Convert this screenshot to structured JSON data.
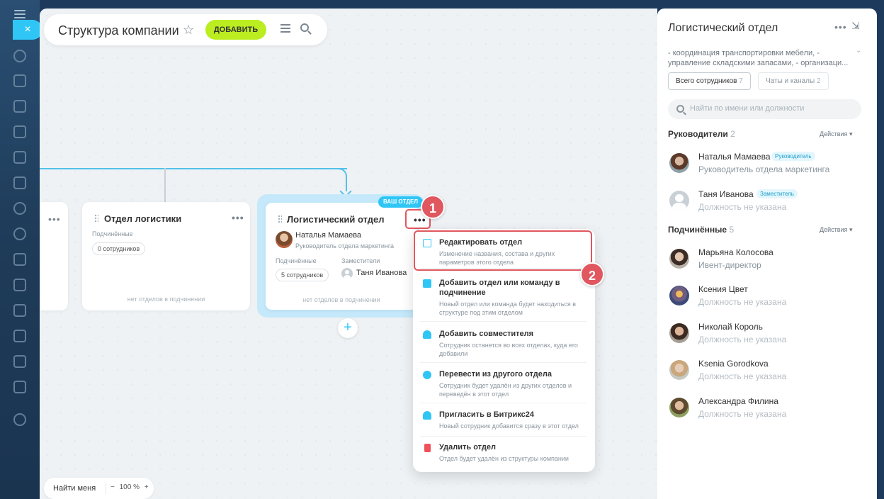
{
  "app": {
    "title": "Структура компании",
    "add_label": "ДОБАВИТЬ",
    "close_symbol": "×"
  },
  "canvas": {
    "find_me_label": "Найти меня",
    "zoom_minus": "−",
    "zoom_value": "100 %",
    "zoom_plus": "+",
    "add_child_symbol": "+"
  },
  "cards": {
    "logistics": {
      "name": "Отдел логистики",
      "subordinates_label": "Подчинённые",
      "subordinates_count": "0 сотрудников",
      "footer": "нет отделов в подчинении"
    },
    "logistic_dept": {
      "badge": "ВАШ ОТДЕЛ",
      "name": "Логистический отдел",
      "head_name": "Наталья Мамаева",
      "head_role": "Руководитель отдела маркетинга",
      "subordinates_label": "Подчинённые",
      "subordinates_count": "5 сотрудников",
      "deputies_label": "Заместители",
      "deputy_name": "Таня Иванова",
      "footer": "нет отделов в подчинении"
    }
  },
  "steps": [
    "1",
    "2"
  ],
  "menu": {
    "items": [
      {
        "title": "Редактировать отдел",
        "desc": "Изменение названия, состава и других параметров этого отдела",
        "icon": "edit-icon",
        "color": "#2fc6f6"
      },
      {
        "title": "Добавить отдел или команду в подчинение",
        "desc": "Новый отдел или команда будет находиться в структуре под этим отделом",
        "icon": "cube-add-icon",
        "color": "#2fc6f6"
      },
      {
        "title": "Добавить совместителя",
        "desc": "Сотрудник останется во всех отделах, куда его добавили",
        "icon": "user-add-icon",
        "color": "#2fc6f6"
      },
      {
        "title": "Перевести из другого отдела",
        "desc": "Сотрудник будет удалён из других отделов и переведён в этот отдел",
        "icon": "user-transfer-icon",
        "color": "#2fc6f6"
      },
      {
        "title": "Пригласить в Битрикс24",
        "desc": "Новый сотрудник добавится сразу в этот отдел",
        "icon": "invite-icon",
        "color": "#2fc6f6"
      },
      {
        "title": "Удалить отдел",
        "desc": "Отдел будет удалён из структуры компании",
        "icon": "trash-icon",
        "color": "#f0505a"
      }
    ]
  },
  "panel": {
    "title": "Логистический отдел",
    "description": "- координация транспортировки мебели, - управление складскими запасами, - организаци...",
    "tab_employees": "Всего сотрудников",
    "tab_employees_count": "7",
    "tab_chats": "Чаты и каналы",
    "tab_chats_count": "2",
    "search_placeholder": "Найти по имени или должности",
    "heads_label": "Руководители",
    "heads_count": "2",
    "actions_label": "Действия",
    "subs_label": "Подчинённые",
    "subs_count": "5",
    "heads": [
      {
        "name": "Наталья Мамаева",
        "badge": "Руководитель",
        "role": "Руководитель отдела маркетинга"
      },
      {
        "name": "Таня Иванова",
        "badge": "Заместитель",
        "role": "Должность не указана"
      }
    ],
    "subordinates": [
      {
        "name": "Марьяна Колосова",
        "role": "Ивент-директор"
      },
      {
        "name": "Ксения Цвет",
        "role": "Должность не указана"
      },
      {
        "name": "Николай Король",
        "role": "Должность не указана"
      },
      {
        "name": "Ksenia Gorodkova",
        "role": "Должность не указана"
      },
      {
        "name": "Александра Филина",
        "role": "Должность не указана"
      }
    ]
  },
  "colors": {
    "accent": "#2fc6f6",
    "add_button": "#bbed21",
    "highlight": "#e0575f"
  }
}
